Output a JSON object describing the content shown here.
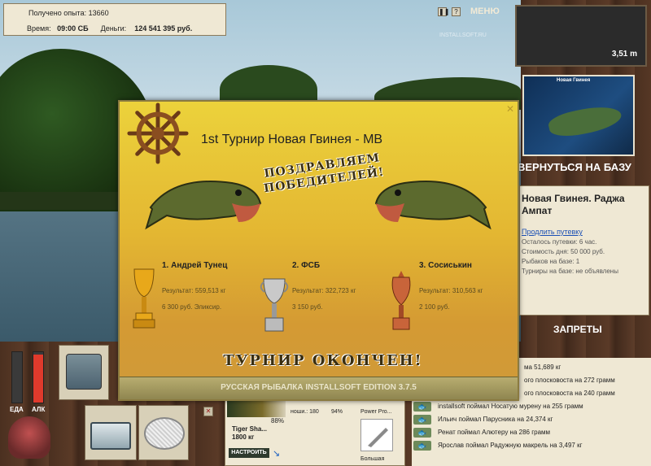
{
  "hud": {
    "experience_label": "Получено опыта:",
    "experience_value": "13660",
    "time_label": "Время:",
    "time_value": "09:00 СБ",
    "money_label": "Деньги:",
    "money_value": "124 541 395 руб.",
    "menu_label": "МЕНЮ",
    "pause_icon": "pause-icon",
    "help_icon": "help-icon"
  },
  "depth": {
    "value": "3,51 m"
  },
  "map": {
    "title": "Новая Гвинея"
  },
  "base": {
    "back_label": "ВЕРНУТЬСЯ НА БАЗУ"
  },
  "location": {
    "title": "Новая Гвинея. Раджа Ампат",
    "extend_link": "Продлить путевку",
    "lines": [
      "Осталось путевки: 6 час.",
      "Стоимость дня: 50 000 руб.",
      "Рыбаков на базе: 1",
      "Турниры на базе: не объявлены"
    ]
  },
  "bans": {
    "title": "ЗАПРЕТЫ"
  },
  "catch_feed": [
    "ма 51,689 кг",
    "ого плосковоста на 272 грамм",
    "ого плосковоста на 240 грамм",
    "installsoft поймал Носатую мурену на 255 грамм",
    "Ильич поймал Парусника на 24,374 кг",
    "Ренат поймал Алютеру на 286 грамм",
    "Ярослав поймал Радужную макрель на 3,497 кг"
  ],
  "gauges": {
    "food_label": "ЕДА",
    "alc_label": "АЛК",
    "alc_level": 0.95,
    "food_level": 0.0
  },
  "rod": {
    "name": "Tiger Sha...",
    "length": "1800 кг",
    "percent": "88%",
    "setup_label": "НАСТРОИТЬ",
    "line_stats": "ноши.: 180",
    "line_percent": "94%",
    "reel_name": "Power Pro...",
    "lure_name": "Большая"
  },
  "tournament": {
    "title": "1st Турнир Новая Гвинея - МВ",
    "congrats": "ПОЗДРАВЛЯЕМ ПОБЕДИТЕЛЕЙ!",
    "winners": [
      {
        "place": "1. Андрей Тунец",
        "result": "Результат: 559,513 кг",
        "prize": "6 300 руб. Эликсир."
      },
      {
        "place": "2. ФСБ",
        "result": "Результат: 322,723 кг",
        "prize": "3 150 руб."
      },
      {
        "place": "3. Сосиськин",
        "result": "Результат: 310,563 кг",
        "prize": "2 100 руб."
      }
    ],
    "finished": "ТУРНИР ОКОНЧЕН!",
    "footer": "РУССКАЯ РЫБАЛКА INSTALLSOFT EDITION 3.7.5",
    "close_icon": "close-icon"
  },
  "watermark": "INSTALLSOFT.RU",
  "colors": {
    "modal_top": "#ecd23b",
    "modal_bottom": "#cf9a3a",
    "alc_fill": "#e03a2c"
  }
}
